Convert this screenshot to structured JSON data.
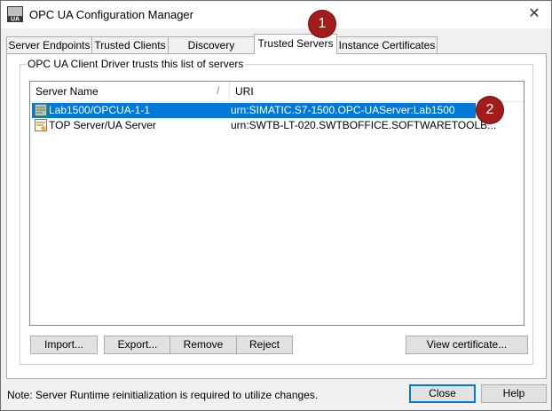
{
  "window": {
    "title": "OPC UA Configuration Manager",
    "app_icon": "ua-app-icon",
    "close_glyph": "✕"
  },
  "tabs": [
    {
      "label": "Server Endpoints"
    },
    {
      "label": "Trusted Clients"
    },
    {
      "label": "Discovery Servers"
    },
    {
      "label": "Trusted Servers",
      "active": true
    },
    {
      "label": "Instance Certificates"
    }
  ],
  "group": {
    "label": "OPC UA Client Driver trusts this list of servers"
  },
  "list": {
    "columns": [
      "Server Name",
      "URI"
    ],
    "rows": [
      {
        "name": "Lab1500/OPCUA-1-1",
        "uri": "urn:SIMATIC.S7-1500.OPC-UAServer:Lab1500",
        "selected": true,
        "icon": "rejected-certificate-icon"
      },
      {
        "name": "TOP Server/UA Server",
        "uri": "urn:SWTB-LT-020.SWTBOFFICE.SOFTWARETOOLB...",
        "selected": false,
        "icon": "trusted-certificate-icon"
      }
    ]
  },
  "buttons": {
    "import": "Import...",
    "export": "Export...",
    "remove": "Remove",
    "reject": "Reject",
    "view_certificate": "View certificate..."
  },
  "footer": {
    "note": "Note: Server Runtime reinitialization is required to utilize changes.",
    "close": "Close",
    "help": "Help"
  },
  "callouts": [
    "1",
    "2"
  ],
  "colors": {
    "selection": "#0078d7",
    "callout": "#a31c1c"
  }
}
